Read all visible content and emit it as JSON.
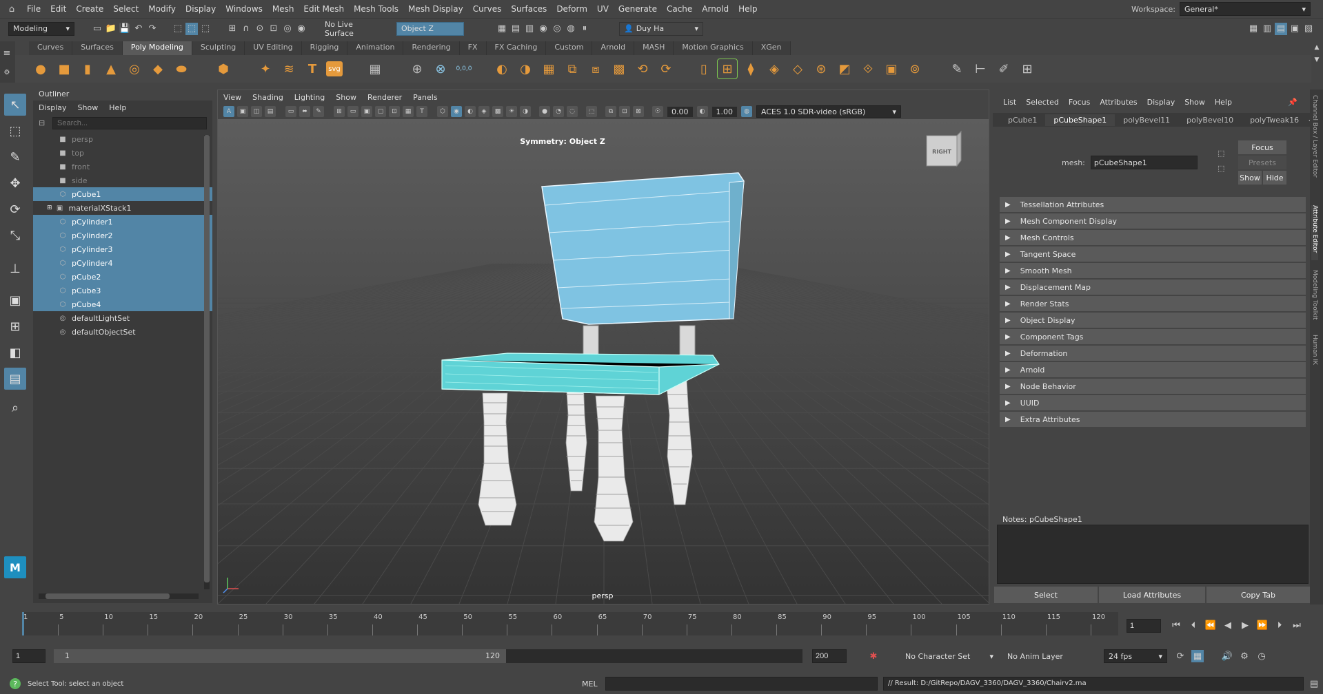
{
  "menubar": {
    "items": [
      "File",
      "Edit",
      "Create",
      "Select",
      "Modify",
      "Display",
      "Windows",
      "Mesh",
      "Edit Mesh",
      "Mesh Tools",
      "Mesh Display",
      "Curves",
      "Surfaces",
      "Deform",
      "UV",
      "Generate",
      "Cache",
      "Arnold",
      "Help"
    ],
    "workspace_label": "Workspace:",
    "workspace_value": "General*"
  },
  "toolbar": {
    "menuset": "Modeling",
    "live_surface": "No Live Surface",
    "symmetry": "Object Z",
    "user": "Duy Ha"
  },
  "shelf": {
    "tabs": [
      "Curves",
      "Surfaces",
      "Poly Modeling",
      "Sculpting",
      "UV Editing",
      "Rigging",
      "Animation",
      "Rendering",
      "FX",
      "FX Caching",
      "Custom",
      "Arnold",
      "MASH",
      "Motion Graphics",
      "XGen"
    ],
    "active_tab": "Poly Modeling",
    "svg_label": "svg",
    "text_label": "T",
    "coord_label": "0,0,0"
  },
  "outliner": {
    "title": "Outliner",
    "menu": [
      "Display",
      "Show",
      "Help"
    ],
    "search_placeholder": "Search...",
    "items": [
      {
        "label": "persp",
        "type": "camera",
        "selected": false
      },
      {
        "label": "top",
        "type": "camera",
        "selected": false
      },
      {
        "label": "front",
        "type": "camera",
        "selected": false
      },
      {
        "label": "side",
        "type": "camera",
        "selected": false
      },
      {
        "label": "pCube1",
        "type": "mesh",
        "selected": true
      },
      {
        "label": "materialXStack1",
        "type": "stack",
        "selected": false
      },
      {
        "label": "pCylinder1",
        "type": "mesh",
        "selected": true
      },
      {
        "label": "pCylinder2",
        "type": "mesh",
        "selected": true
      },
      {
        "label": "pCylinder3",
        "type": "mesh",
        "selected": true
      },
      {
        "label": "pCylinder4",
        "type": "mesh",
        "selected": true
      },
      {
        "label": "pCube2",
        "type": "mesh",
        "selected": true
      },
      {
        "label": "pCube3",
        "type": "mesh",
        "selected": true
      },
      {
        "label": "pCube4",
        "type": "mesh",
        "selected": true
      },
      {
        "label": "defaultLightSet",
        "type": "set",
        "selected": false
      },
      {
        "label": "defaultObjectSet",
        "type": "set",
        "selected": false
      }
    ]
  },
  "viewport": {
    "menu": [
      "View",
      "Shading",
      "Lighting",
      "Show",
      "Renderer",
      "Panels"
    ],
    "symmetry_label": "Symmetry: Object Z",
    "camera_label": "persp",
    "viewcube_label": "RIGHT",
    "exposure": "0.00",
    "gamma": "1.00",
    "colorspace": "ACES 1.0 SDR-video (sRGB)"
  },
  "attribute_editor": {
    "menu": [
      "List",
      "Selected",
      "Focus",
      "Attributes",
      "Display",
      "Show",
      "Help"
    ],
    "tabs": [
      "pCube1",
      "pCubeShape1",
      "polyBevel11",
      "polyBevel10",
      "polyTweak16"
    ],
    "active_tab": "pCubeShape1",
    "mesh_label": "mesh:",
    "mesh_value": "pCubeShape1",
    "focus_button": "Focus",
    "presets_button": "Presets",
    "show_button": "Show",
    "hide_button": "Hide",
    "sections": [
      "Tessellation Attributes",
      "Mesh Component Display",
      "Mesh Controls",
      "Tangent Space",
      "Smooth Mesh",
      "Displacement Map",
      "Render Stats",
      "Object Display",
      "Component Tags",
      "Deformation",
      "Arnold",
      "Node Behavior",
      "UUID",
      "Extra Attributes"
    ],
    "notes_label": "Notes:  pCubeShape1",
    "select_button": "Select",
    "load_button": "Load Attributes",
    "copy_button": "Copy Tab",
    "side_tabs": [
      "Channel Box / Layer Editor",
      "Attribute Editor",
      "Modeling Toolkit",
      "Human IK"
    ]
  },
  "timeline": {
    "ticks": [
      "1",
      "5",
      "10",
      "15",
      "20",
      "25",
      "30",
      "35",
      "40",
      "45",
      "50",
      "55",
      "60",
      "65",
      "70",
      "75",
      "80",
      "85",
      "90",
      "95",
      "100",
      "105",
      "110",
      "115",
      "120"
    ],
    "current_frame": "1"
  },
  "range": {
    "start": "1",
    "inner_start": "1",
    "inner_end": "120",
    "end": "200",
    "character_set": "No Character Set",
    "anim_layer": "No Anim Layer",
    "fps": "24 fps"
  },
  "status": {
    "help_text": "Select Tool: select an object",
    "mel_label": "MEL",
    "result": "// Result: D:/GitRepo/DAGV_3360/DAGV_3360/Chairv2.ma"
  },
  "colors": {
    "selection": "#5285a6",
    "chair_fill": "#7fc3e2",
    "seat_fill": "#6fd0dc",
    "legs": "#e8e8e8",
    "grid": "#555555"
  }
}
